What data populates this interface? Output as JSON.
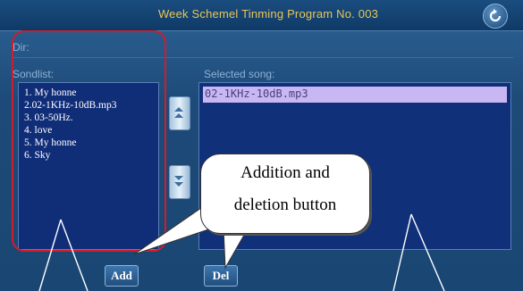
{
  "window": {
    "title": "Week Schemel Tinming Program No. 003",
    "back_icon": "return-icon"
  },
  "labels": {
    "dir": "Dir:",
    "songlist": "Sondlist:",
    "selected": "Selected song:"
  },
  "songlist": {
    "items": [
      "1. My honne",
      "2.02-1KHz-10dB.mp3",
      "3. 03-50Hz.",
      "4. love",
      "5. My honne",
      "6. Sky"
    ]
  },
  "selected": {
    "items": [
      "02-1KHz-10dB.mp3"
    ]
  },
  "buttons": {
    "add": "Add",
    "del": "Del",
    "move_up_icon": "arrow-up-icon",
    "move_down_icon": "arrow-down-icon"
  },
  "annotation": {
    "line1": "Addition and",
    "line2": "deletion button",
    "outline_color": "#d11c2d"
  },
  "colors": {
    "title": "#e8c65a",
    "list_bg": "#102d78",
    "selection": "#c9b7f3"
  }
}
